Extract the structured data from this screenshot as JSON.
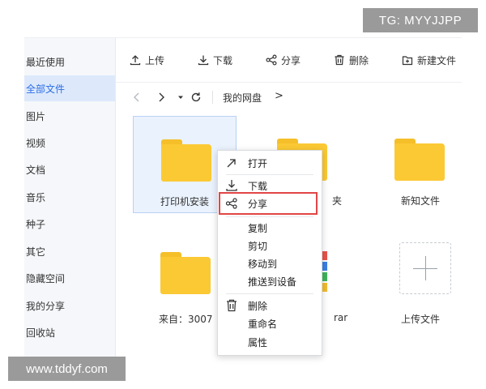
{
  "watermarks": {
    "top": "TG: MYYJJPP",
    "bottom": "www.tddyf.com"
  },
  "sidebar": {
    "items": [
      {
        "label": "最近使用"
      },
      {
        "label": "全部文件",
        "active": true
      },
      {
        "label": "图片"
      },
      {
        "label": "视频"
      },
      {
        "label": "文档"
      },
      {
        "label": "音乐"
      },
      {
        "label": "种子"
      },
      {
        "label": "其它"
      },
      {
        "label": "隐藏空间"
      },
      {
        "label": "我的分享"
      },
      {
        "label": "回收站"
      }
    ]
  },
  "toolbar": {
    "upload": "上传",
    "download": "下载",
    "share": "分享",
    "delete": "删除",
    "new_folder": "新建文件"
  },
  "breadcrumb": {
    "root": "我的网盘",
    "separator": ">"
  },
  "files": [
    {
      "name": "打印机安装",
      "type": "folder",
      "selected": true
    },
    {
      "name": "夹",
      "type": "folder"
    },
    {
      "name": "新知文件",
      "type": "folder"
    },
    {
      "name": "来自：3007",
      "type": "folder"
    },
    {
      "name": "rar",
      "type": "archive"
    },
    {
      "name": "上传文件",
      "type": "upload"
    }
  ],
  "context_menu": {
    "items": [
      {
        "label": "打开",
        "icon": "arrow-up-right-icon"
      },
      {
        "label": "下载",
        "icon": "download-icon"
      },
      {
        "label": "分享",
        "icon": "share-icon",
        "highlighted": true
      },
      {
        "label": "复制"
      },
      {
        "label": "剪切"
      },
      {
        "label": "移动到"
      },
      {
        "label": "推送到设备"
      },
      {
        "label": "删除",
        "icon": "trash-icon"
      },
      {
        "label": "重命名"
      },
      {
        "label": "属性"
      }
    ]
  },
  "colors": {
    "accent": "#2d6de6",
    "folder": "#fbc934",
    "highlight_border": "#e24646",
    "selection_bg": "#eaf2fd"
  }
}
